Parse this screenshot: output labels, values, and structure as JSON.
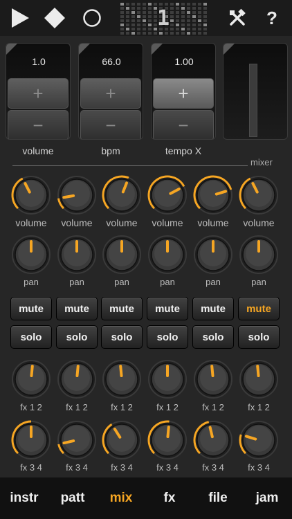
{
  "toolbar": {
    "play_icon": "play-icon",
    "stop_icon": "stop-icon",
    "record_icon": "record-icon",
    "step_number": "1",
    "tools_icon": "tools-icon",
    "help_label": "?"
  },
  "transport": [
    {
      "value": "1.0",
      "label": "volume",
      "plus": "+",
      "minus": "−"
    },
    {
      "value": "66.0",
      "label": "bpm",
      "plus": "+",
      "minus": "−"
    },
    {
      "value": "1.00",
      "label": "tempo X",
      "plus": "+",
      "minus": "−"
    }
  ],
  "mixer_label": "mixer",
  "channels": [
    {
      "volume_label": "volume",
      "volume_level": 0.4,
      "pan_label": "pan",
      "pan_level": 0.5,
      "mute": "mute",
      "mute_on": false,
      "solo": "solo",
      "fx12_label": "fx 1 2",
      "fx12_level": 0.52,
      "fx34_label": "fx 3 4",
      "fx34_level": 0.5
    },
    {
      "volume_label": "volume",
      "volume_level": 0.13,
      "pan_label": "pan",
      "pan_level": 0.5,
      "mute": "mute",
      "mute_on": false,
      "solo": "solo",
      "fx12_label": "fx 1 2",
      "fx12_level": 0.52,
      "fx34_label": "fx 3 4",
      "fx34_level": 0.12
    },
    {
      "volume_label": "volume",
      "volume_level": 0.58,
      "pan_label": "pan",
      "pan_level": 0.5,
      "mute": "mute",
      "mute_on": false,
      "solo": "solo",
      "fx12_label": "fx 1 2",
      "fx12_level": 0.48,
      "fx34_label": "fx 3 4",
      "fx34_level": 0.38
    },
    {
      "volume_label": "volume",
      "volume_level": 0.73,
      "pan_label": "pan",
      "pan_level": 0.5,
      "mute": "mute",
      "mute_on": false,
      "solo": "solo",
      "fx12_label": "fx 1 2",
      "fx12_level": 0.5,
      "fx34_label": "fx 3 4",
      "fx34_level": 0.52
    },
    {
      "volume_label": "volume",
      "volume_level": 0.77,
      "pan_label": "pan",
      "pan_level": 0.5,
      "mute": "mute",
      "mute_on": false,
      "solo": "solo",
      "fx12_label": "fx 1 2",
      "fx12_level": 0.48,
      "fx34_label": "fx 3 4",
      "fx34_level": 0.45
    },
    {
      "volume_label": "volume",
      "volume_level": 0.4,
      "pan_label": "pan",
      "pan_level": 0.5,
      "mute": "mute",
      "mute_on": true,
      "solo": "solo",
      "fx12_label": "fx 1 2",
      "fx12_level": 0.48,
      "fx34_label": "fx 3 4",
      "fx34_level": 0.23
    }
  ],
  "nav": [
    {
      "label": "instr",
      "active": false
    },
    {
      "label": "patt",
      "active": false
    },
    {
      "label": "mix",
      "active": true
    },
    {
      "label": "fx",
      "active": false
    },
    {
      "label": "file",
      "active": false
    },
    {
      "label": "jam",
      "active": false
    }
  ],
  "colors": {
    "accent": "#f6a623",
    "background": "#262626",
    "toolbar": "#1b1b1b",
    "navbar": "#111111",
    "knob_body": "#3a3a3a"
  }
}
